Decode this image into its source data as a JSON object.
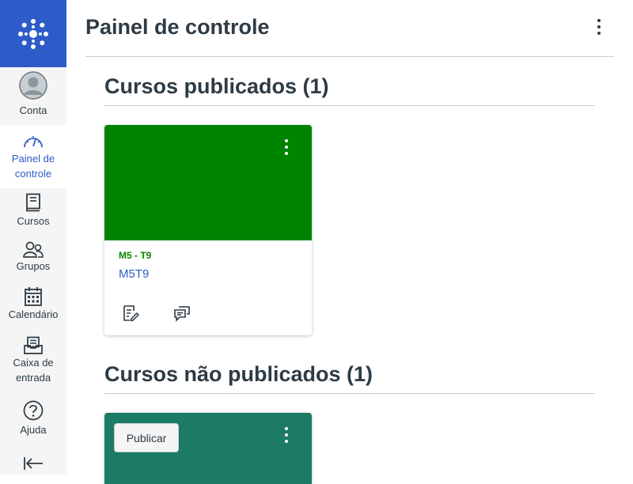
{
  "brand": {
    "logo_icon": "canvas-logo-icon",
    "color": "#2d5bc8"
  },
  "nav": {
    "account": {
      "label": "Conta",
      "icon": "avatar-icon"
    },
    "dashboard": {
      "label_line1": "Painel de",
      "label_line2": "controle",
      "icon": "dashboard-icon",
      "active": true
    },
    "courses": {
      "label": "Cursos",
      "icon": "book-icon"
    },
    "groups": {
      "label": "Grupos",
      "icon": "groups-icon"
    },
    "calendar": {
      "label": "Calendário",
      "icon": "calendar-icon"
    },
    "inbox": {
      "label_line1": "Caixa de",
      "label_line2": "entrada",
      "icon": "inbox-icon"
    },
    "help": {
      "label": "Ajuda",
      "icon": "help-icon"
    },
    "collapse": {
      "icon": "collapse-arrow-icon"
    }
  },
  "header": {
    "title": "Painel de controle",
    "menu_icon": "kebab-icon"
  },
  "published": {
    "title": "Cursos publicados (1)",
    "card": {
      "color": "#008400",
      "code": "M5 - T9",
      "name": "M5T9",
      "icons": [
        "assignments-icon",
        "discussions-icon"
      ]
    }
  },
  "unpublished": {
    "title": "Cursos não publicados (1)",
    "card": {
      "color": "#1b7b66",
      "publish_label": "Publicar"
    }
  }
}
